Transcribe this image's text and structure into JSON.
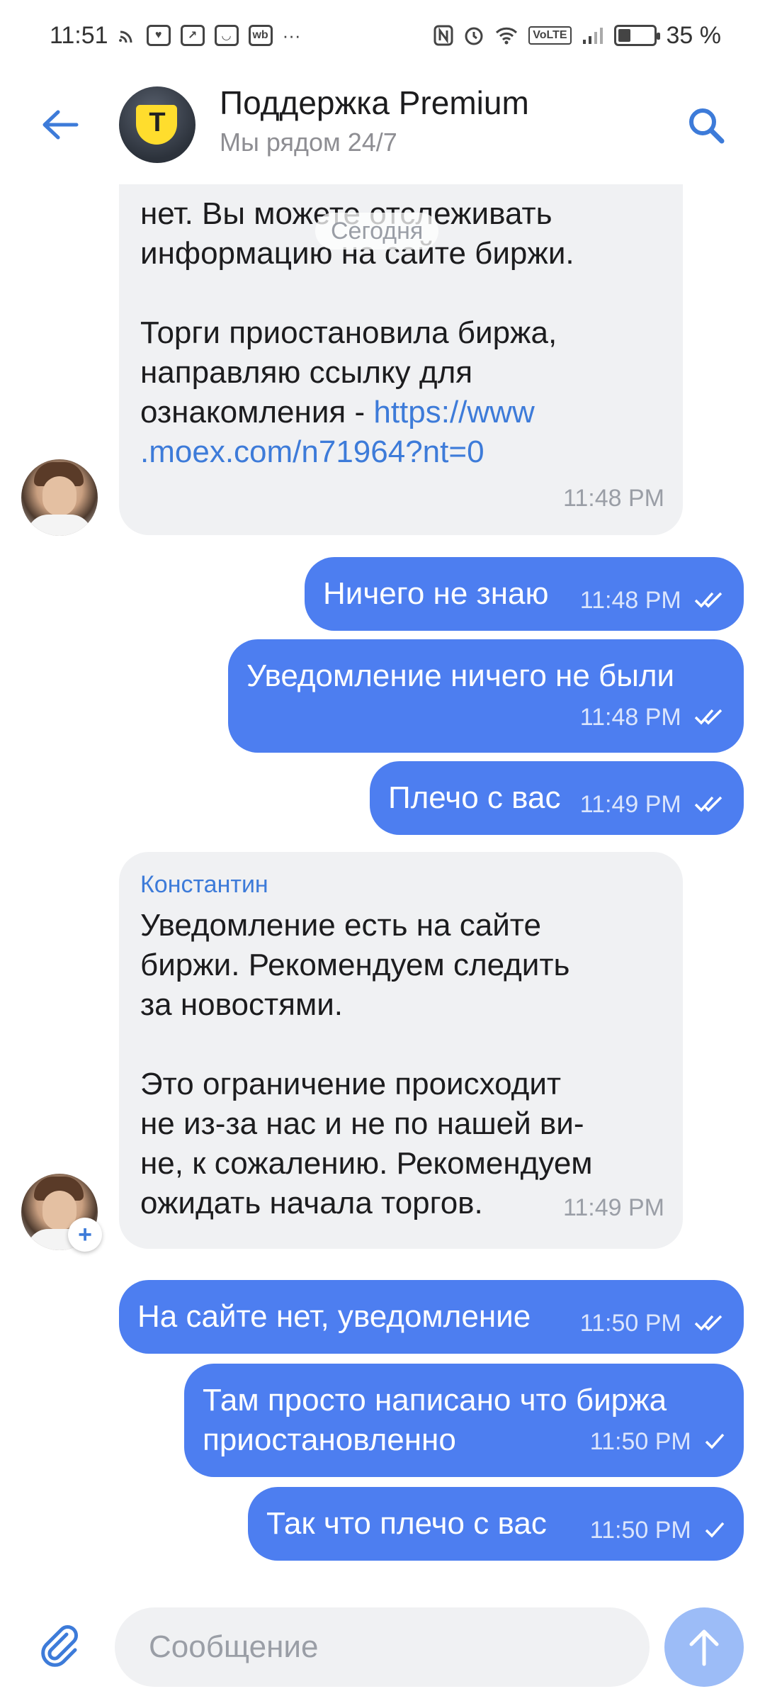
{
  "status_bar": {
    "time": "11:51",
    "more": "···",
    "network_badge": "VoLTE",
    "battery_percent": "35 %",
    "battery_level": 0.35,
    "icons": [
      "cast-icon",
      "heart-app-icon",
      "arrow-app-icon",
      "smile-app-icon",
      "wb-app-icon",
      "nfc-icon",
      "alarm-icon",
      "wifi-icon",
      "volte-icon",
      "signal-icon",
      "battery-icon"
    ],
    "wb_label": "wb"
  },
  "header": {
    "title": "Поддержка Premium",
    "subtitle": "Мы рядом 24/7",
    "avatar_letter": "Т",
    "brand_color": "#ffdd2d"
  },
  "date_separator": "Сегодня",
  "messages": [
    {
      "direction": "incoming",
      "text_top": "нет. Вы можете отслеживать\nинформацию на сайте биржи.\n\nТорги приостановила биржа,\nнаправляю ссылку для\nознакомления - ",
      "link": "https://www\n.moex.com/n71964?nt=0",
      "time": "11:48 PM"
    },
    {
      "direction": "outgoing",
      "text": "Ничего не знаю",
      "time": "11:48 PM",
      "status": "read"
    },
    {
      "direction": "outgoing",
      "text": "Уведомление ничего не были",
      "time": "11:48 PM",
      "status": "read"
    },
    {
      "direction": "outgoing",
      "text": "Плечо с вас",
      "time": "11:49 PM",
      "status": "read"
    },
    {
      "direction": "incoming",
      "sender": "Константин",
      "text": "Уведомление есть на сайте\nбиржи. Рекомендуем следить\nза новостями.\n\nЭто ограничение происходит\nне из-за нас и не по нашей ви-\nне, к сожалению. Рекомендуем\nожидать начала торгов.",
      "time": "11:49 PM"
    },
    {
      "direction": "outgoing",
      "text": "На сайте нет, уведомление",
      "time": "11:50 PM",
      "status": "read"
    },
    {
      "direction": "outgoing",
      "text": "Там просто написано что биржа\nприостановленно",
      "time": "11:50 PM",
      "status": "sent"
    },
    {
      "direction": "outgoing",
      "text": "Так что плечо с вас",
      "time": "11:50 PM",
      "status": "sent"
    }
  ],
  "composer": {
    "placeholder": "Сообщение",
    "value": ""
  },
  "colors": {
    "outgoing_bubble": "#4d7ef0",
    "incoming_bubble": "#f0f1f3",
    "accent": "#3d7bd9"
  }
}
